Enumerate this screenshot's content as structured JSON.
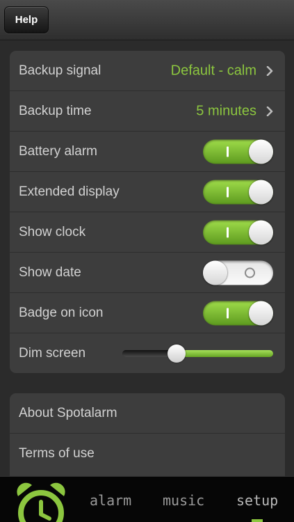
{
  "header": {
    "help_label": "Help"
  },
  "settings": {
    "backup_signal": {
      "label": "Backup signal",
      "value": "Default - calm"
    },
    "backup_time": {
      "label": "Backup time",
      "value": "5 minutes"
    },
    "battery_alarm": {
      "label": "Battery alarm",
      "on": true
    },
    "extended_display": {
      "label": "Extended display",
      "on": true
    },
    "show_clock": {
      "label": "Show clock",
      "on": true
    },
    "show_date": {
      "label": "Show date",
      "on": false
    },
    "badge_on_icon": {
      "label": "Badge on icon",
      "on": true
    },
    "dim_screen": {
      "label": "Dim screen",
      "level": 0.36
    }
  },
  "info": {
    "about_label": "About Spotalarm",
    "terms_label": "Terms of use"
  },
  "tabbar": {
    "logo_icon": "alarm-clock-icon",
    "tabs": [
      {
        "label": "alarm"
      },
      {
        "label": "music"
      },
      {
        "label": "setup",
        "active": true
      }
    ]
  },
  "colors": {
    "accent": "#8cc63f",
    "background": "#2b2b2b",
    "panel": "#3d3d3d"
  }
}
